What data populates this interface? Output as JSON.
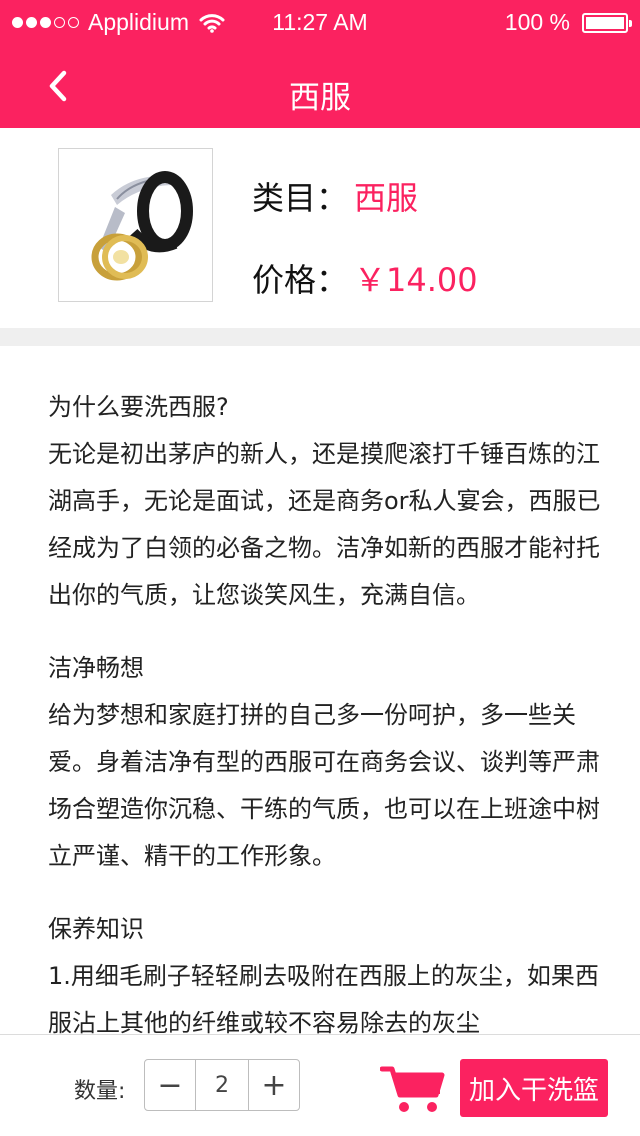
{
  "status_bar": {
    "carrier": "Applidium",
    "time": "11:27  AM",
    "battery": "100  %",
    "signal_bars_filled": 3,
    "signal_bars_total": 5
  },
  "nav": {
    "title": "西服",
    "back_icon": "chevron-left-icon"
  },
  "product": {
    "image_alt": "belt-image",
    "category_label": "类目：",
    "category_value": "西服",
    "price_label": "价格：",
    "price_value": "￥14.00"
  },
  "content": {
    "sections": [
      {
        "heading": "为什么要洗西服?",
        "body": "无论是初出茅庐的新人，还是摸爬滚打千锤百炼的江湖高手，无论是面试，还是商务or私人宴会，西服已经成为了白领的必备之物。洁净如新的西服才能衬托出你的气质，让您谈笑风生，充满自信。"
      },
      {
        "heading": "洁净畅想",
        "body": "给为梦想和家庭打拼的自己多一份呵护，多一些关爱。身着洁净有型的西服可在商务会议、谈判等严肃场合塑造你沉稳、干练的气质，也可以在上班途中树立严谨、精干的工作形象。"
      },
      {
        "heading": "保养知识",
        "body": "1.用细毛刷子轻轻刷去吸附在西服上的灰尘，如果西服沾上其他的纤维或较不容易除去的灰尘"
      }
    ]
  },
  "bottom_bar": {
    "quantity_label": "数量:",
    "quantity_value": "2",
    "minus_label": "−",
    "plus_label": "+",
    "add_button_label": "加入干洗篮",
    "accent_color": "#fb2260"
  }
}
